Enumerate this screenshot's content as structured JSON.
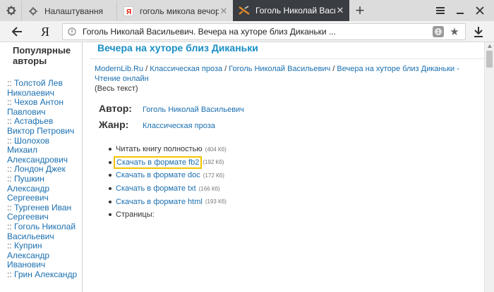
{
  "tabs": [
    {
      "label": "Налаштування"
    },
    {
      "label": "гоголь микола вечори на х"
    },
    {
      "label": "Гоголь Николай Василь"
    }
  ],
  "address_bar": {
    "url": "Гоголь Николай Васильевич. Вечера на хуторе близ Диканьки ..."
  },
  "browser_logo": "Я",
  "sidebar": {
    "title": "Популярные авторы",
    "separator": "::",
    "authors": [
      "Толстой Лев Николаевич",
      "Чехов Антон Павлович",
      "Астафьев Виктор Петрович",
      "Шолохов Михаил Александрович",
      "Лондон Джек",
      "Пушкин Александр Сергеевич",
      "Тургенев Иван Сергеевич",
      "Гоголь Николай Васильевич",
      "Куприн Александр Иванович",
      "Грин Александр"
    ]
  },
  "main": {
    "book_title": "Вечера на хуторе близ Диканьки",
    "breadcrumb": {
      "items": [
        "ModernLib.Ru",
        "Классическая проза",
        "Гоголь Николай Васильевич",
        "Вечера на хуторе близ Диканьки - Чтение онлайн"
      ],
      "suffix": "(Весь текст)"
    },
    "author_label": "Автор:",
    "author_value": "Гоголь Николай Васильевич",
    "genre_label": "Жанр:",
    "genre_value": "Классическая проза",
    "downloads": [
      {
        "label": "Читать книгу полностью",
        "size": "(404 Кб)",
        "linked": false
      },
      {
        "label": "Скачать в формате fb2",
        "size": "(192 Кб)",
        "linked": true,
        "highlight": true
      },
      {
        "label": "Скачать в формате doc",
        "size": "(172 Кб)",
        "linked": true
      },
      {
        "label": "Скачать в формате txt",
        "size": "(166 Кб)",
        "linked": true
      },
      {
        "label": "Скачать в формате html",
        "size": "(193 Кб)",
        "linked": true
      },
      {
        "label": "Страницы:",
        "size": "",
        "linked": false
      }
    ]
  },
  "colors": {
    "link": "#1a6fb0",
    "title": "#1a8fc6",
    "highlight": "#f4c400",
    "active_tab": "#3a3d42"
  }
}
